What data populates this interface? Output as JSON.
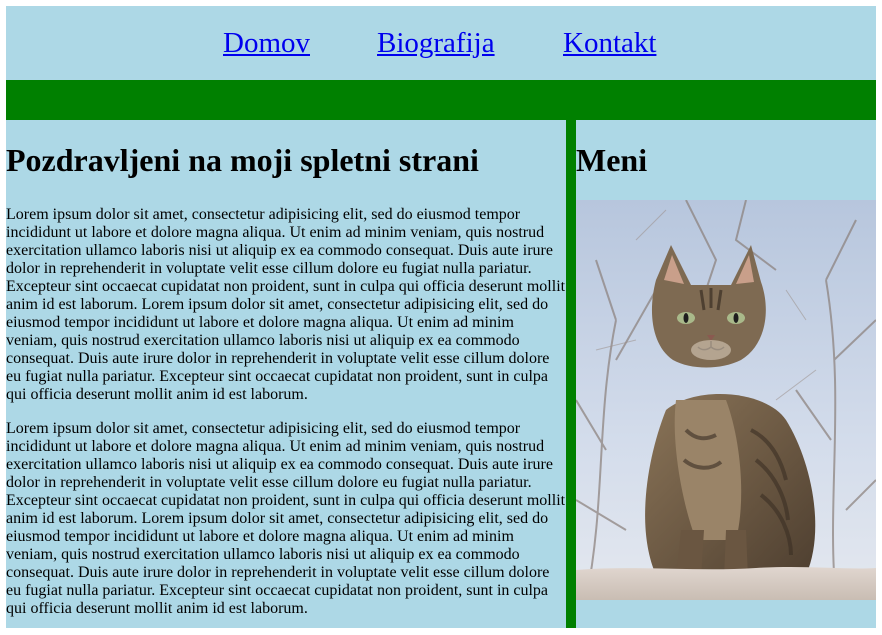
{
  "nav": {
    "links": [
      "Domov",
      "Biografija",
      "Kontakt"
    ]
  },
  "main": {
    "heading": "Pozdravljeni na moji spletni strani",
    "paragraphs": [
      "Lorem ipsum dolor sit amet, consectetur adipisicing elit, sed do eiusmod tempor incididunt ut labore et dolore magna aliqua. Ut enim ad minim veniam, quis nostrud exercitation ullamco laboris nisi ut aliquip ex ea commodo consequat. Duis aute irure dolor in reprehenderit in voluptate velit esse cillum dolore eu fugiat nulla pariatur. Excepteur sint occaecat cupidatat non proident, sunt in culpa qui officia deserunt mollit anim id est laborum. Lorem ipsum dolor sit amet, consectetur adipisicing elit, sed do eiusmod tempor incididunt ut labore et dolore magna aliqua. Ut enim ad minim veniam, quis nostrud exercitation ullamco laboris nisi ut aliquip ex ea commodo consequat. Duis aute irure dolor in reprehenderit in voluptate velit esse cillum dolore eu fugiat nulla pariatur. Excepteur sint occaecat cupidatat non proident, sunt in culpa qui officia deserunt mollit anim id est laborum.",
      "Lorem ipsum dolor sit amet, consectetur adipisicing elit, sed do eiusmod tempor incididunt ut labore et dolore magna aliqua. Ut enim ad minim veniam, quis nostrud exercitation ullamco laboris nisi ut aliquip ex ea commodo consequat. Duis aute irure dolor in reprehenderit in voluptate velit esse cillum dolore eu fugiat nulla pariatur. Excepteur sint occaecat cupidatat non proident, sunt in culpa qui officia deserunt mollit anim id est laborum. Lorem ipsum dolor sit amet, consectetur adipisicing elit, sed do eiusmod tempor incididunt ut labore et dolore magna aliqua. Ut enim ad minim veniam, quis nostrud exercitation ullamco laboris nisi ut aliquip ex ea commodo consequat. Duis aute irure dolor in reprehenderit in voluptate velit esse cillum dolore eu fugiat nulla pariatur. Excepteur sint occaecat cupidatat non proident, sunt in culpa qui officia deserunt mollit anim id est laborum."
    ]
  },
  "aside": {
    "heading": "Meni",
    "image_icon": "tabby-cat-photo"
  },
  "colors": {
    "background": "#add8e6",
    "accent": "#008000",
    "link": "#0000ee"
  }
}
